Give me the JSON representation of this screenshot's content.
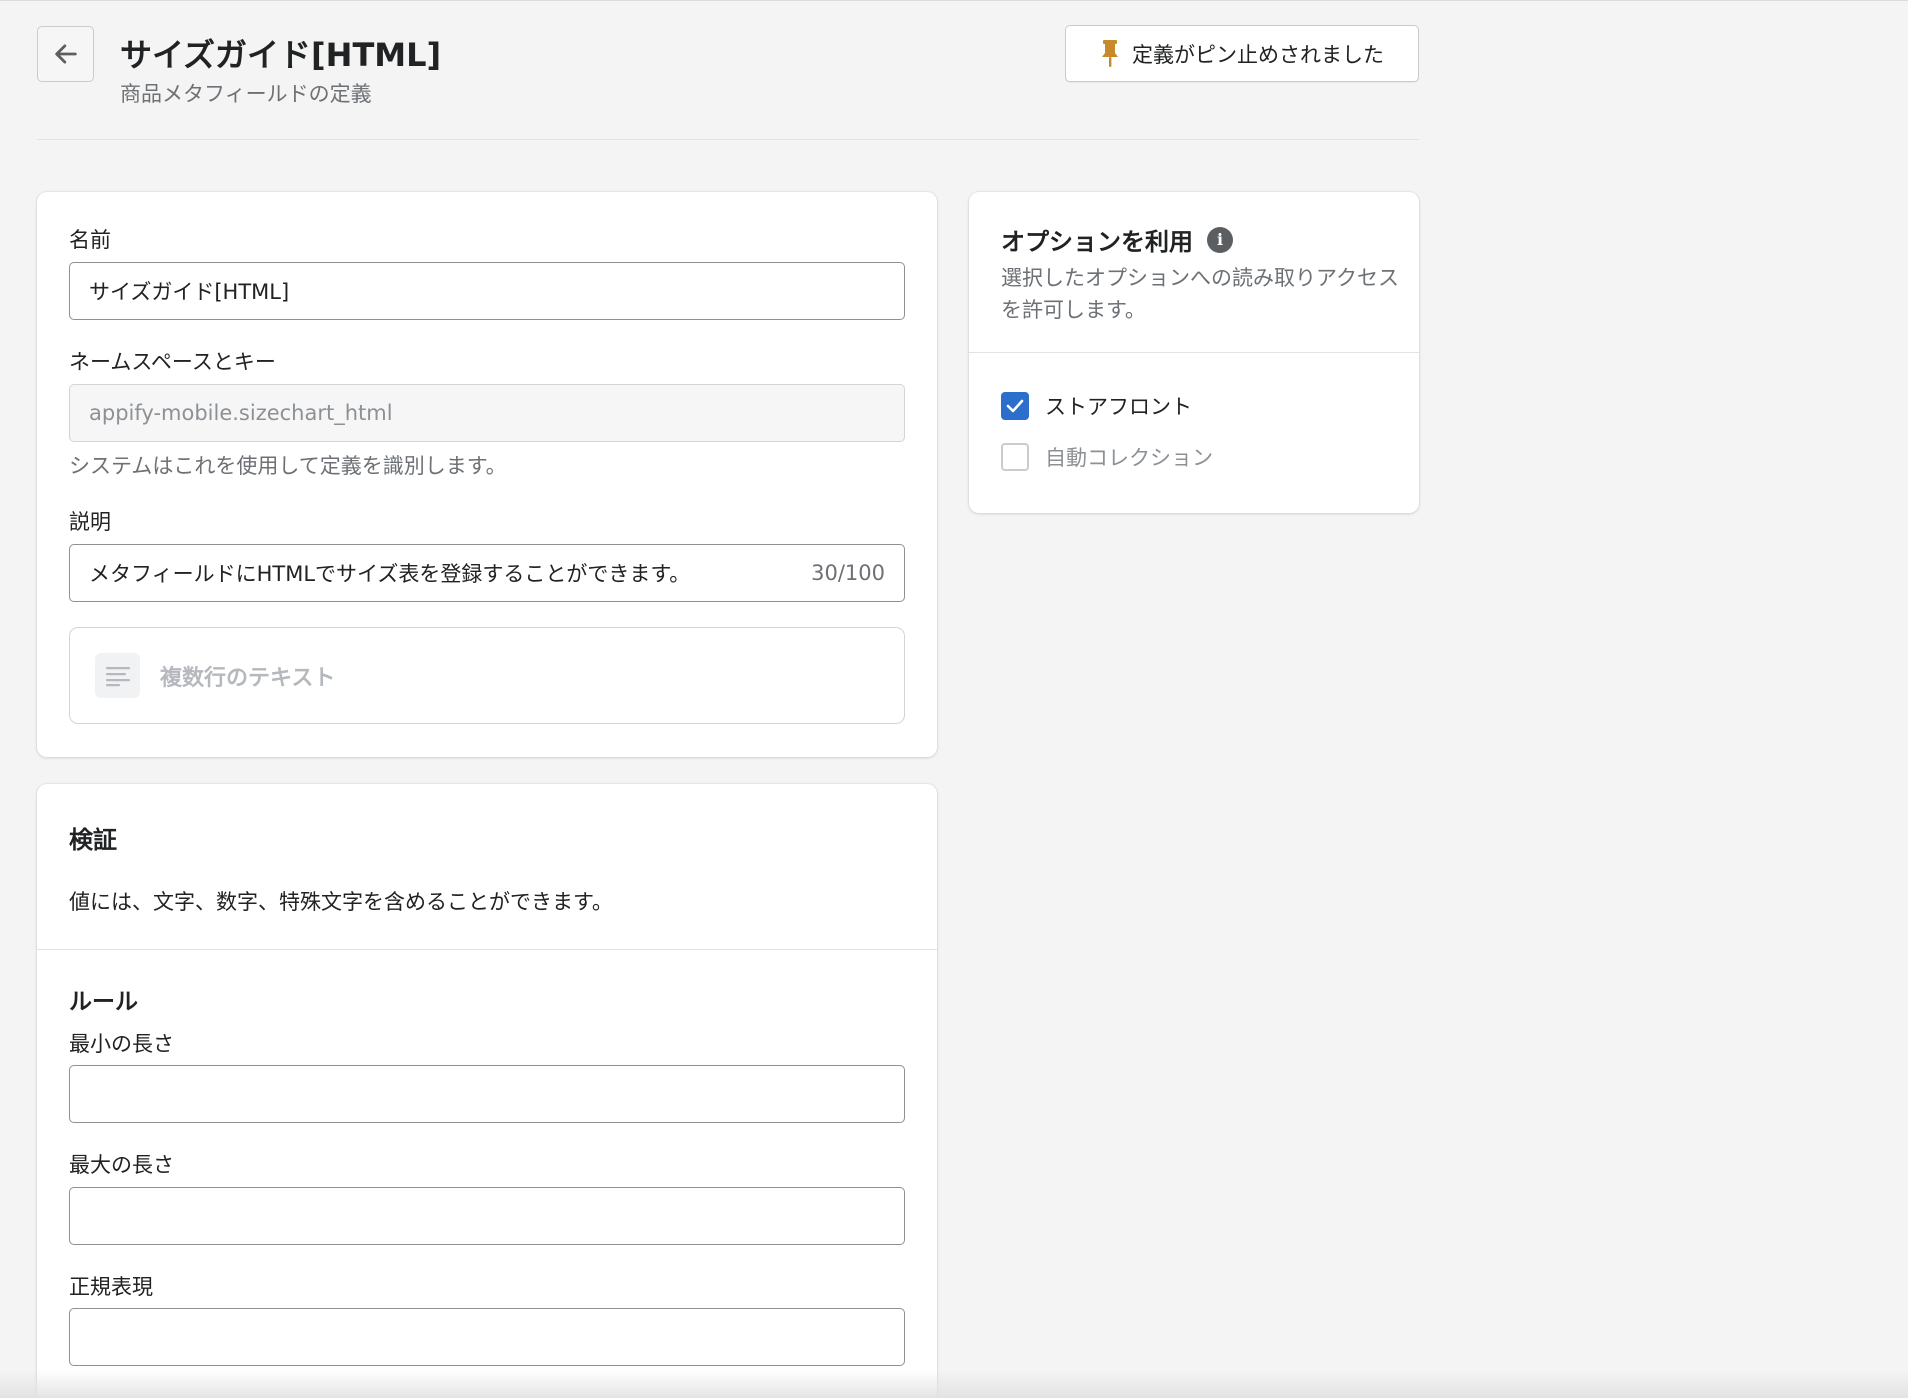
{
  "header": {
    "title": "サイズガイド[HTML]",
    "subtitle": "商品メタフィールドの定義",
    "pin_button_label": "定義がピン止めされました"
  },
  "main_card": {
    "name_label": "名前",
    "name_value": "サイズガイド[HTML]",
    "namespace_label": "ネームスペースとキー",
    "namespace_value": "appify-mobile.sizechart_html",
    "namespace_help": "システムはこれを使用して定義を識別します。",
    "description_label": "説明",
    "description_value": "メタフィールドにHTMLでサイズ表を登録することができます。",
    "description_counter": "30/100",
    "type_label": "複数行のテキスト"
  },
  "options_card": {
    "title": "オプションを利用",
    "description": "選択したオプションへの読み取りアクセスを許可します。",
    "options": [
      {
        "label": "ストアフロント",
        "checked": true,
        "disabled": false
      },
      {
        "label": "自動コレクション",
        "checked": false,
        "disabled": true
      }
    ]
  },
  "validation_card": {
    "title": "検証",
    "description": "値には、文字、数字、特殊文字を含めることができます。",
    "rules_title": "ルール",
    "min_length_label": "最小の長さ",
    "min_length_value": "",
    "max_length_label": "最大の長さ",
    "max_length_value": "",
    "regex_label": "正規表現",
    "regex_value": ""
  },
  "colors": {
    "accent": "#2c6ecb",
    "pin_icon": "#c8892a",
    "background": "#f4f4f4"
  },
  "icons": [
    "arrow-left-icon",
    "pin-icon",
    "info-icon",
    "checkmark-icon",
    "multiline-text-icon"
  ]
}
